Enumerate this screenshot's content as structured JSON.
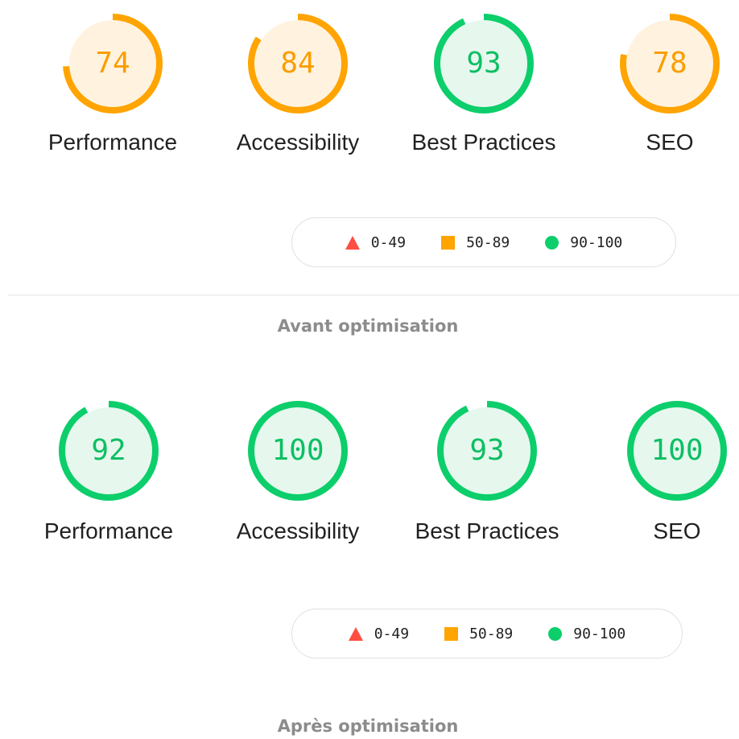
{
  "colors": {
    "pass": "#0cce6b",
    "pass_bg": "#e6f8ee",
    "pass_text": "#008800",
    "average": "#ffa400",
    "average_bg": "#fff3e0",
    "average_text": "#c33300",
    "fail": "#ff4e42"
  },
  "before": {
    "caption": "Avant optimisation",
    "gauges": [
      {
        "score": "74",
        "label": "Performance",
        "status": "average"
      },
      {
        "score": "84",
        "label": "Accessibility",
        "status": "average"
      },
      {
        "score": "93",
        "label": "Best Practices",
        "status": "pass"
      },
      {
        "score": "78",
        "label": "SEO",
        "status": "average"
      }
    ],
    "legend": {
      "fail_range": "0-49",
      "average_range": "50-89",
      "pass_range": "90-100"
    }
  },
  "after": {
    "caption": "Après optimisation",
    "gauges": [
      {
        "score": "92",
        "label": "Performance",
        "status": "pass"
      },
      {
        "score": "100",
        "label": "Accessibility",
        "status": "pass"
      },
      {
        "score": "93",
        "label": "Best Practices",
        "status": "pass"
      },
      {
        "score": "100",
        "label": "SEO",
        "status": "pass"
      }
    ],
    "legend": {
      "fail_range": "0-49",
      "average_range": "50-89",
      "pass_range": "90-100"
    }
  }
}
